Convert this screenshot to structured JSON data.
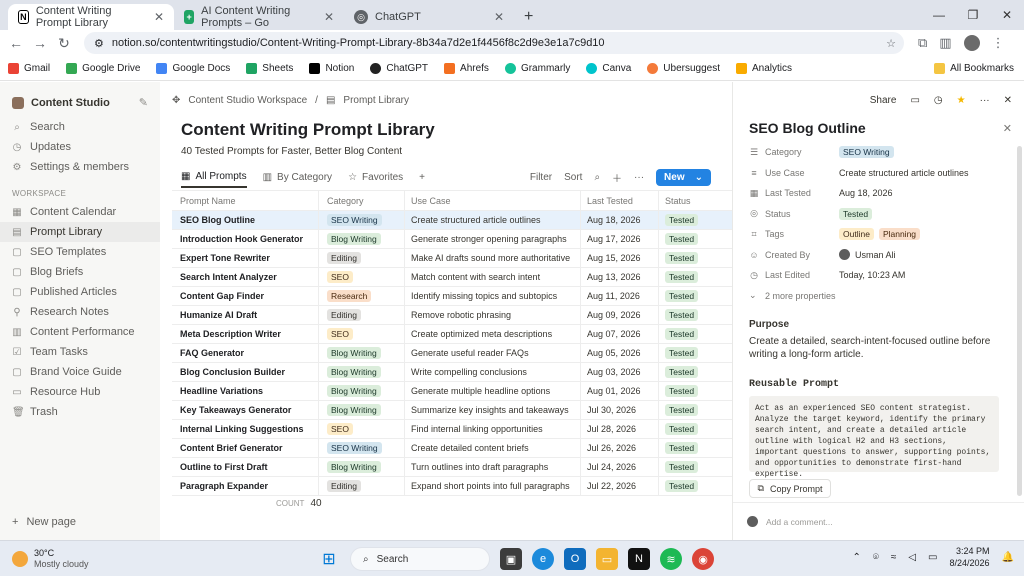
{
  "browser": {
    "tabs": [
      {
        "title": "Content Writing Prompt Library",
        "icon": "notion-icon",
        "color": "#ffffff",
        "active": true
      },
      {
        "title": "AI Content Writing Prompts – Go",
        "icon": "sheets-icon",
        "color": "#1fa463",
        "active": false
      },
      {
        "title": "ChatGPT",
        "icon": "chatgpt-icon",
        "color": "#5f6368",
        "active": false
      }
    ],
    "url": "notion.so/contentwritingstudio/Content-Writing-Prompt-Library-8b34a7d2e1f4456f8c2d9e3e1a7c9d10",
    "bookmarks": [
      "Gmail",
      "Google Drive",
      "Google Docs",
      "Sheets",
      "Notion",
      "ChatGPT",
      "Ahrefs",
      "Grammarly",
      "Canva",
      "Ubersuggest",
      "Analytics"
    ],
    "all_bookmarks": "All Bookmarks"
  },
  "sidebar": {
    "workspace": "Content Studio",
    "top": [
      "Search",
      "Updates",
      "Settings & members"
    ],
    "section": "WORKSPACE",
    "items": [
      "Content Calendar",
      "Prompt Library",
      "SEO Templates",
      "Blog Briefs",
      "Published Articles",
      "Research Notes",
      "Content Performance",
      "Team Tasks",
      "Brand Voice Guide",
      "Resource Hub",
      "Trash"
    ],
    "new_page": "New page"
  },
  "main": {
    "breadcrumb": [
      "Content Studio Workspace",
      "Prompt Library"
    ],
    "title": "Content Writing Prompt Library",
    "subtitle": "40 Tested Prompts for Faster, Better Blog Content",
    "views": [
      "All Prompts",
      "By Category",
      "Favorites"
    ],
    "tools": [
      "Filter",
      "Sort"
    ],
    "new_label": "New",
    "columns": [
      "Prompt Name",
      "Category",
      "Use Case",
      "Last Tested",
      "Status"
    ],
    "rows": [
      [
        "SEO Blog Outline",
        "SEO Writing",
        "Create structured article outlines",
        "Aug 18, 2026",
        "Tested"
      ],
      [
        "Introduction Hook Generator",
        "Blog Writing",
        "Generate stronger opening paragraphs",
        "Aug 17, 2026",
        "Tested"
      ],
      [
        "Expert Tone Rewriter",
        "Editing",
        "Make AI drafts sound more authoritative",
        "Aug 15, 2026",
        "Tested"
      ],
      [
        "Search Intent Analyzer",
        "SEO",
        "Match content with search intent",
        "Aug 13, 2026",
        "Tested"
      ],
      [
        "Content Gap Finder",
        "Research",
        "Identify missing topics and subtopics",
        "Aug 11, 2026",
        "Tested"
      ],
      [
        "Humanize AI Draft",
        "Editing",
        "Remove robotic phrasing",
        "Aug 09, 2026",
        "Tested"
      ],
      [
        "Meta Description Writer",
        "SEO",
        "Create optimized meta descriptions",
        "Aug 07, 2026",
        "Tested"
      ],
      [
        "FAQ Generator",
        "Blog Writing",
        "Generate useful reader FAQs",
        "Aug 05, 2026",
        "Tested"
      ],
      [
        "Blog Conclusion Builder",
        "Blog Writing",
        "Write compelling conclusions",
        "Aug 03, 2026",
        "Tested"
      ],
      [
        "Headline Variations",
        "Blog Writing",
        "Generate multiple headline options",
        "Aug 01, 2026",
        "Tested"
      ],
      [
        "Key Takeaways Generator",
        "Blog Writing",
        "Summarize key insights and takeaways",
        "Jul 30, 2026",
        "Tested"
      ],
      [
        "Internal Linking Suggestions",
        "SEO",
        "Find internal linking opportunities",
        "Jul 28, 2026",
        "Tested"
      ],
      [
        "Content Brief Generator",
        "SEO Writing",
        "Create detailed content briefs",
        "Jul 26, 2026",
        "Tested"
      ],
      [
        "Outline to First Draft",
        "Blog Writing",
        "Turn outlines into draft paragraphs",
        "Jul 24, 2026",
        "Tested"
      ],
      [
        "Paragraph Expander",
        "Editing",
        "Expand short points into full paragraphs",
        "Jul 22, 2026",
        "Tested"
      ]
    ],
    "count_label": "COUNT",
    "count_value": "40"
  },
  "panel": {
    "share": "Share",
    "title": "SEO Blog Outline",
    "props": [
      {
        "key": "Category",
        "icon": "list-icon",
        "tags": [
          "SEO Writing"
        ]
      },
      {
        "key": "Use Case",
        "icon": "lines-icon",
        "value": "Create structured article outlines"
      },
      {
        "key": "Last Tested",
        "icon": "calendar-icon",
        "value": "Aug 18, 2026"
      },
      {
        "key": "Status",
        "icon": "status-icon",
        "tags": [
          "Tested"
        ]
      },
      {
        "key": "Tags",
        "icon": "tag-icon",
        "tags": [
          "Outline",
          "Planning"
        ]
      },
      {
        "key": "Created By",
        "icon": "person-icon",
        "value": "Usman Ali"
      },
      {
        "key": "Last Edited",
        "icon": "clock-icon",
        "value": "Today, 10:23 AM"
      }
    ],
    "more_props": "2 more properties",
    "purpose_heading": "Purpose",
    "purpose_text": "Create a detailed, search-intent-focused outline before writing a long-form article.",
    "reusable_heading": "Reusable Prompt",
    "prompt_text": "Act as an experienced SEO content strategist. Analyze the target keyword, identify the primary search intent, and create a detailed article outline with logical H2 and H3 sections, important questions to answer, supporting points, and opportunities to demonstrate first-hand expertise.",
    "copy_label": "Copy Prompt",
    "comment_placeholder": "Add a comment..."
  },
  "taskbar": {
    "temp": "30°C",
    "weather": "Mostly cloudy",
    "search": "Search",
    "time": "3:24 PM",
    "date": "8/24/2026"
  }
}
